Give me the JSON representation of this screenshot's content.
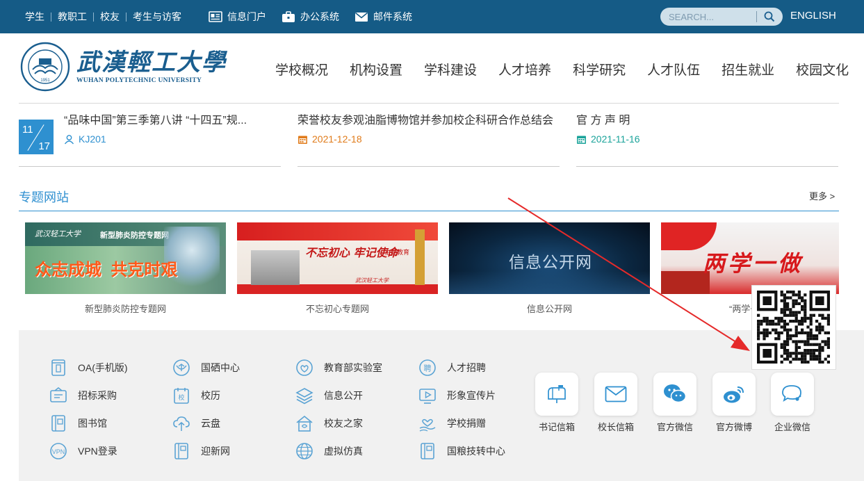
{
  "topbar": {
    "links": [
      "学生",
      "教职工",
      "校友",
      "考生与访客"
    ],
    "systems": [
      {
        "label": "信息门户",
        "icon": "portal-icon"
      },
      {
        "label": "办公系统",
        "icon": "briefcase-icon"
      },
      {
        "label": "邮件系统",
        "icon": "mail-icon"
      }
    ],
    "search_placeholder": "SEARCH...",
    "language": "ENGLISH"
  },
  "header": {
    "logo_cn": "武漢輕工大學",
    "logo_en": "WUHAN POLYTECHNIC UNIVERSITY",
    "seal_year": "1951",
    "nav": [
      "学校概况",
      "机构设置",
      "学科建设",
      "人才培养",
      "科学研究",
      "人才队伍",
      "招生就业",
      "校园文化"
    ]
  },
  "news": [
    {
      "date_month": "11",
      "date_day": "17",
      "title": "“品味中国”第三季第八讲 “十四五”规...",
      "meta": "KJ201",
      "meta_icon": "location-icon",
      "meta_color": "#2e90d0"
    },
    {
      "title": "荣誉校友参观油脂博物馆并参加校企科研合作总结会",
      "meta": "2021-12-18",
      "meta_icon": "calendar-icon",
      "meta_color": "#e07b1a"
    },
    {
      "title": "官 方 声 明",
      "meta": "2021-11-16",
      "meta_icon": "calendar-icon",
      "meta_color": "#1aa39a"
    }
  ],
  "topics": {
    "title": "专题网站",
    "more": "更多 >",
    "cards": [
      {
        "caption": "新型肺炎防控专题网",
        "banner_text": "众志成城  共克时艰",
        "banner_sub": "新型肺炎防控专题网",
        "banner_logo": "武汉轻工大学"
      },
      {
        "caption": "不忘初心专题网",
        "banner_text": "不忘初心 牢记使命",
        "banner_sub": "主题教育",
        "banner_logo": "武汉轻工大学"
      },
      {
        "caption": "信息公开网",
        "banner_text": "信息公开网"
      },
      {
        "caption": "“两学一做”",
        "banner_text": "两学一做"
      }
    ]
  },
  "quick_links": [
    {
      "label": "OA(手机版)",
      "icon": "phone-icon"
    },
    {
      "label": "国硒中心",
      "icon": "selenium-icon"
    },
    {
      "label": "教育部实验室",
      "icon": "lab-icon"
    },
    {
      "label": "人才招聘",
      "icon": "recruit-icon"
    },
    {
      "label": "招标采购",
      "icon": "tender-icon"
    },
    {
      "label": "校历",
      "icon": "calendar-icon"
    },
    {
      "label": "信息公开",
      "icon": "layers-icon"
    },
    {
      "label": "形象宣传片",
      "icon": "video-icon"
    },
    {
      "label": "图书馆",
      "icon": "library-icon"
    },
    {
      "label": "云盘",
      "icon": "cloud-icon"
    },
    {
      "label": "校友之家",
      "icon": "home-icon"
    },
    {
      "label": "学校捐赠",
      "icon": "donate-icon"
    },
    {
      "label": "VPN登录",
      "icon": "vpn-icon"
    },
    {
      "label": "迎新网",
      "icon": "book-icon"
    },
    {
      "label": "虚拟仿真",
      "icon": "globe-icon"
    },
    {
      "label": "国粮技转中心",
      "icon": "book-icon"
    }
  ],
  "contact_buttons": [
    {
      "label": "书记信箱",
      "icon": "mailbox-icon"
    },
    {
      "label": "校长信箱",
      "icon": "envelope-icon"
    },
    {
      "label": "官方微信",
      "icon": "wechat-icon"
    },
    {
      "label": "官方微博",
      "icon": "weibo-icon"
    },
    {
      "label": "企业微信",
      "icon": "work-wechat-icon"
    }
  ],
  "colors": {
    "topbar": "#155b86",
    "accent": "#2e90d0",
    "arrow": "#e52a2a"
  }
}
